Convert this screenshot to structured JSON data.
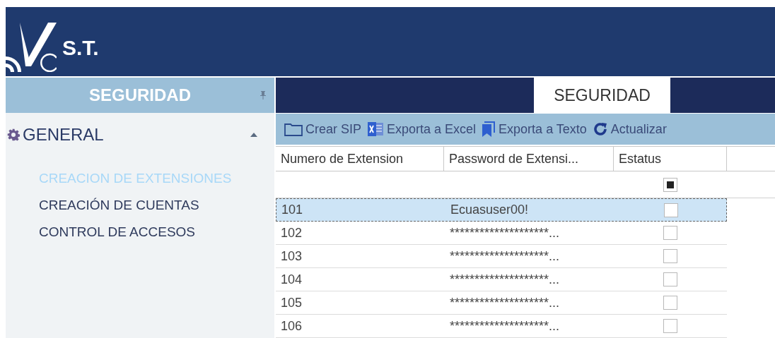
{
  "header": {
    "logo_text": "S.T."
  },
  "sidebar": {
    "title": "SEGURIDAD",
    "groups": [
      {
        "label": "GENERAL",
        "expanded": true,
        "items": [
          {
            "label": "CREACION DE EXTENSIONES",
            "selected": true
          },
          {
            "label": "CREACIÓN DE CUENTAS",
            "selected": false
          },
          {
            "label": "CONTROL DE ACCESOS",
            "selected": false
          }
        ]
      }
    ]
  },
  "tabs": [
    {
      "label": "SEGURIDAD",
      "selected": true
    }
  ],
  "toolbar": [
    {
      "kind": "folder",
      "label": "Crear SIP"
    },
    {
      "kind": "excel",
      "label": "Exporta a Excel"
    },
    {
      "kind": "bookmark",
      "label": "Exporta a Texto"
    },
    {
      "kind": "refresh",
      "label": "Actualizar"
    }
  ],
  "table": {
    "columns": [
      "Numero de Extension",
      "Password de Extensi...",
      "Estatus"
    ],
    "filter_row": {
      "status_filter_indeterminate": true
    },
    "rows": [
      {
        "number": "101",
        "password": "Ecuasuser00!",
        "checked": false,
        "selected": true
      },
      {
        "number": "102",
        "password": "********************...",
        "checked": false,
        "selected": false
      },
      {
        "number": "103",
        "password": "********************...",
        "checked": false,
        "selected": false
      },
      {
        "number": "104",
        "password": "********************...",
        "checked": false,
        "selected": false
      },
      {
        "number": "105",
        "password": "********************...",
        "checked": false,
        "selected": false
      },
      {
        "number": "106",
        "password": "********************...",
        "checked": false,
        "selected": false
      }
    ]
  }
}
